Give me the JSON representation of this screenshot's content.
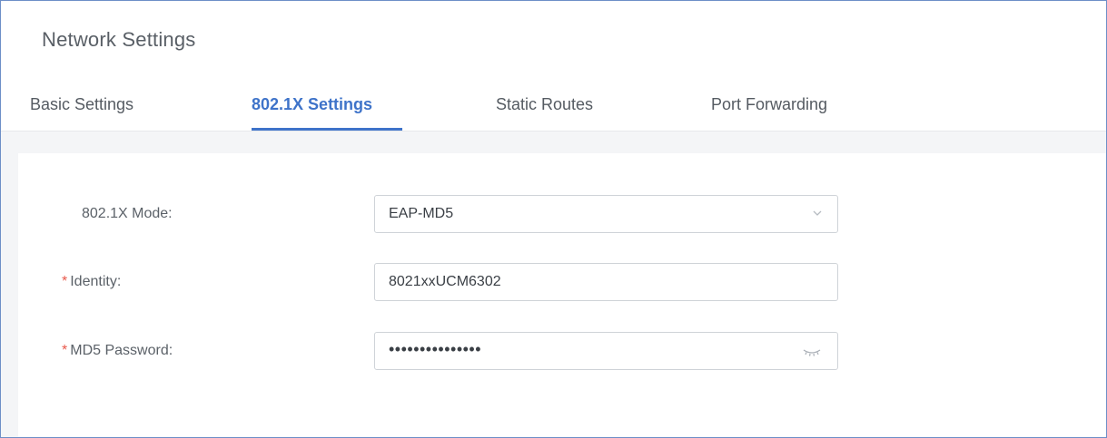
{
  "page": {
    "title": "Network Settings"
  },
  "tabs": [
    {
      "label": "Basic Settings"
    },
    {
      "label": "802.1X Settings"
    },
    {
      "label": "Static Routes"
    },
    {
      "label": "Port Forwarding"
    }
  ],
  "active_tab": "802.1X Settings",
  "form": {
    "mode": {
      "label": "802.1X Mode:",
      "value": "EAP-MD5"
    },
    "identity": {
      "required_mark": "*",
      "label": "Identity:",
      "value": "8021xxUCM6302"
    },
    "password": {
      "required_mark": "*",
      "label": "MD5 Password:",
      "value": "•••••••••••••••"
    }
  },
  "colors": {
    "accent": "#3e73c9",
    "required": "#e8594c",
    "frame_border": "#6d8fc7"
  },
  "icons": {
    "mode_dropdown": "chevron-down-icon",
    "password_toggle": "eye-closed-icon"
  }
}
